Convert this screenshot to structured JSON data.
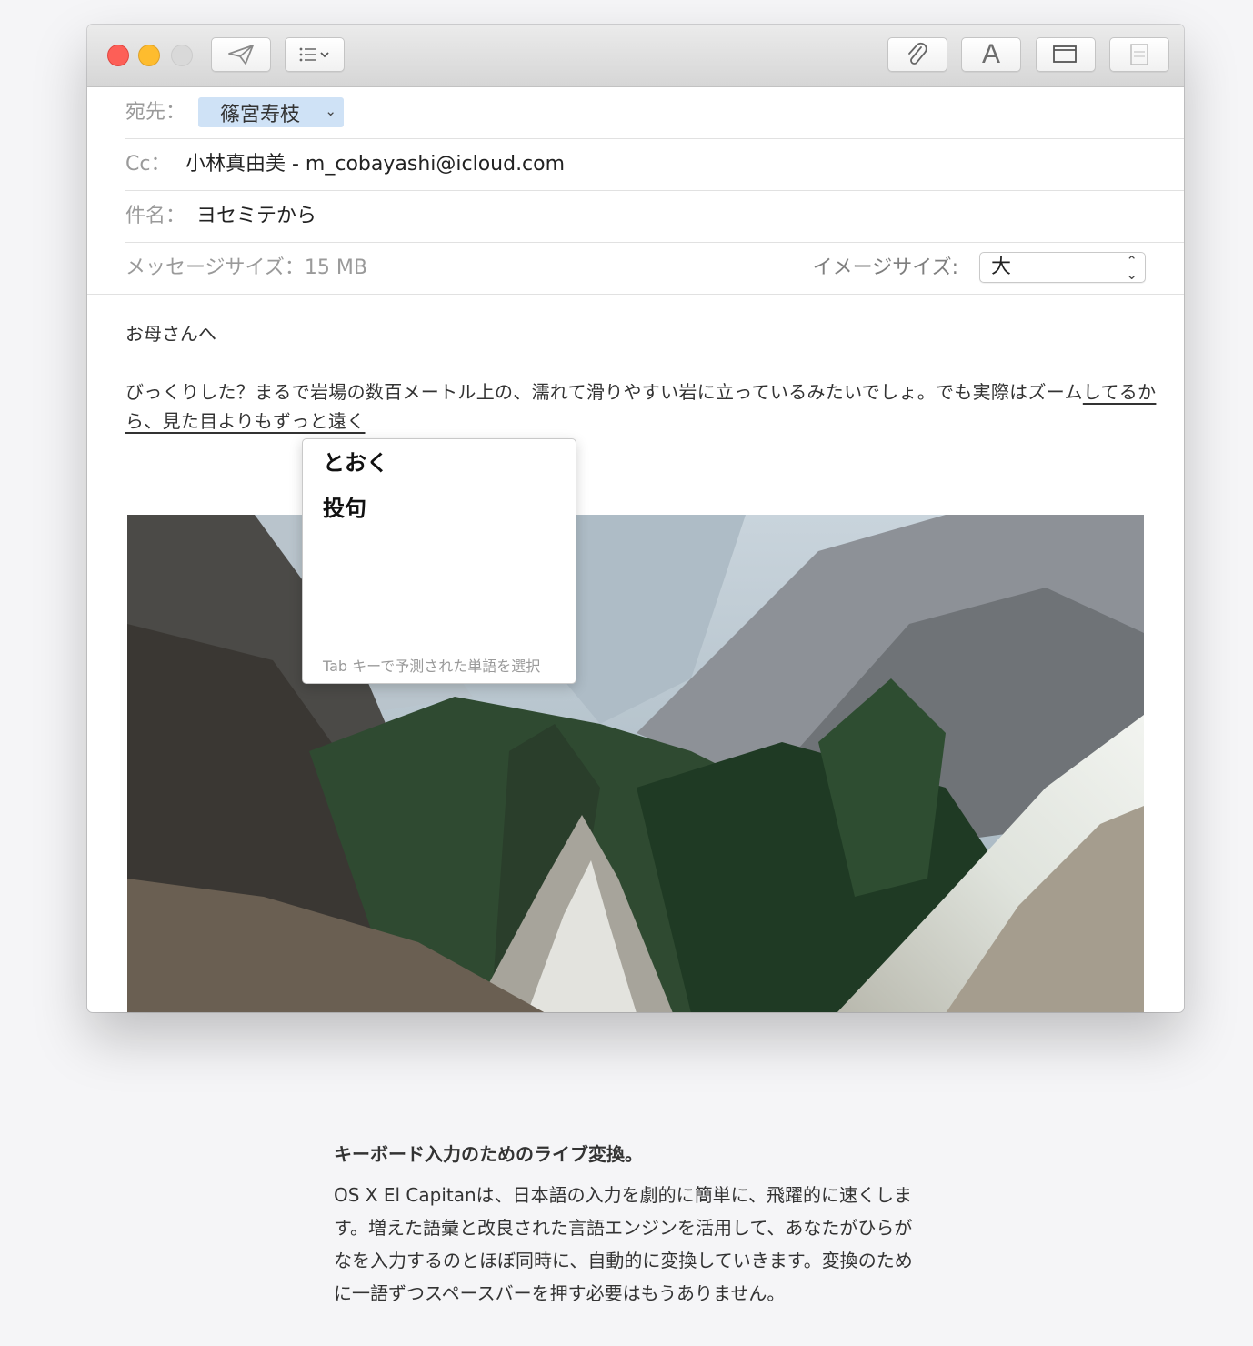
{
  "toolbar": {
    "buttons": [
      "send-icon",
      "header-fields-icon",
      "attachment-icon",
      "format-icon",
      "photo-browser-icon",
      "stationery-icon"
    ],
    "format_letter": "A"
  },
  "header": {
    "to_label": "宛先：",
    "to_value": "篠宮寿枝",
    "cc_label": "Cc：",
    "cc_value": "小林真由美 - m_cobayashi@icloud.com",
    "subject_label": "件名：",
    "subject_value": "ヨセミテから",
    "message_size_label": "メッセージサイズ：",
    "message_size_value": "15 MB",
    "image_size_label": "イメージサイズ:",
    "image_size_value": "大"
  },
  "body": {
    "greeting": "お母さんへ",
    "paragraph_plain": "びっくりした？まるで岩場の数百メートル上の、濡れて滑りやすい岩に立っているみたいでしょ。でも実際はズーム",
    "paragraph_underlined": "してるから、見た目よりもずっと遠く"
  },
  "candidates": {
    "items": [
      "とおく",
      "投句"
    ],
    "hint": "Tab キーで予測された単語を選択"
  },
  "caption": {
    "title": "キーボード入力のためのライブ変換。",
    "text": "OS X El Capitanは、日本語の入力を劇的に簡単に、飛躍的に速くします。増えた語彙と改良された言語エンジンを活用して、あなたがひらがなを入力するのとほぼ同時に、自動的に変換していきます。変換のために一語ずつスペースバーを押す必要はもうありません。"
  },
  "colors": {
    "recipient_chip": "#cfe2f6",
    "close_light": "#fd5f57",
    "minimize_light": "#febc2e"
  }
}
